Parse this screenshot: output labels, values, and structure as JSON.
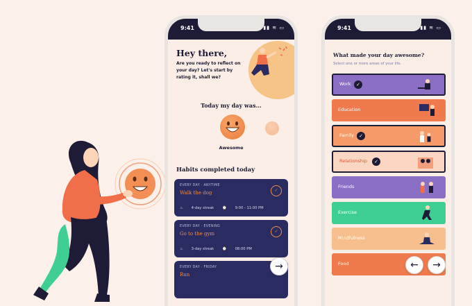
{
  "status_bar": {
    "time": "9:41"
  },
  "screen_rate": {
    "greeting": "Hey there,",
    "intro": "Are you ready to reflect on your day? Let's start by rating it, shall we?",
    "rate_title": "Today my day was...",
    "selected_rating": "Awesome",
    "habits_title": "Habits completed today",
    "habits": [
      {
        "category": "EVERY DAY · ANYTIME",
        "name": "Walk the dog",
        "streak": "4-day streak",
        "time": "9:00 - 11:00 PM"
      },
      {
        "category": "EVERY DAY · EVENING",
        "name": "Go to the gym",
        "streak": "3-day streak",
        "time": "08:00 PM"
      },
      {
        "category": "EVERY DAY · FRIDAY",
        "name": "Run",
        "streak": "",
        "time": ""
      }
    ],
    "next_glyph": "→"
  },
  "screen_areas": {
    "title": "What made your day awesome?",
    "subtitle": "Select one or more areas of your life.",
    "areas": [
      {
        "label": "Work",
        "selected": true,
        "color": "#8a6fc4"
      },
      {
        "label": "Education",
        "selected": false,
        "color": "#ee7a4e"
      },
      {
        "label": "Family",
        "selected": true,
        "color": "#f59b6a"
      },
      {
        "label": "Relationship",
        "selected": true,
        "color": "#fbd7c3"
      },
      {
        "label": "Friends",
        "selected": false,
        "color": "#8a6fc4"
      },
      {
        "label": "Exercise",
        "selected": false,
        "color": "#3fcf92"
      },
      {
        "label": "Mindfulness",
        "selected": false,
        "color": "#f8bf8e"
      },
      {
        "label": "Food",
        "selected": false,
        "color": "#ee7a4e"
      }
    ],
    "prev_glyph": "←",
    "next_glyph": "→"
  },
  "colors": {
    "navy": "#1d1b35",
    "habit_card": "#2a2c61",
    "orange": "#ee7a4e",
    "background": "#fcf1ea"
  }
}
